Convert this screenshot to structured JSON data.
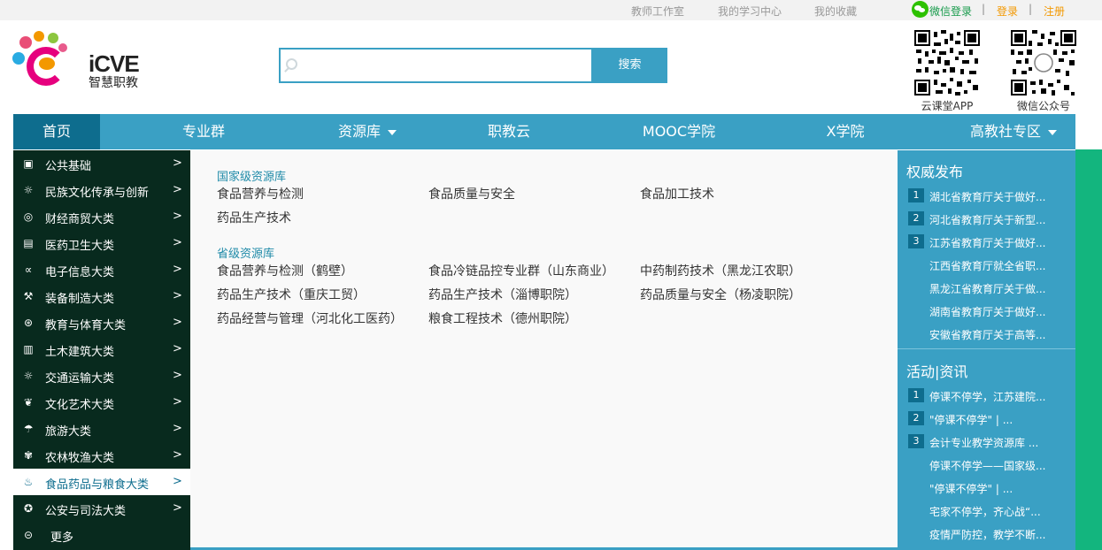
{
  "topbar": {
    "links": [
      "教师工作室",
      "我的学习中心",
      "我的收藏"
    ],
    "wechat_login": "微信登录",
    "login": "登录",
    "register": "注册",
    "separator": "|"
  },
  "brand": {
    "name": "iCVE",
    "subtitle": "智慧职教"
  },
  "search": {
    "placeholder": "",
    "button": "搜索"
  },
  "qr": {
    "app_label": "云课堂APP",
    "wechat_label": "微信公众号"
  },
  "nav": {
    "items": [
      "首页",
      "专业群",
      "资源库",
      "职教云",
      "MOOC学院",
      "X学院",
      "高教社专区"
    ]
  },
  "categories": [
    {
      "label": "公共基础",
      "icon": "book-icon"
    },
    {
      "label": "民族文化传承与创新",
      "icon": "lamp-icon"
    },
    {
      "label": "财经商贸大类",
      "icon": "coin-icon"
    },
    {
      "label": "医药卫生大类",
      "icon": "medical-icon"
    },
    {
      "label": "电子信息大类",
      "icon": "share-icon"
    },
    {
      "label": "装备制造大类",
      "icon": "wrench-icon"
    },
    {
      "label": "教育与体育大类",
      "icon": "ball-icon"
    },
    {
      "label": "土木建筑大类",
      "icon": "building-icon"
    },
    {
      "label": "交通运输大类",
      "icon": "bulb-icon"
    },
    {
      "label": "文化艺术大类",
      "icon": "leaf-icon"
    },
    {
      "label": "旅游大类",
      "icon": "umbrella-icon"
    },
    {
      "label": "农林牧渔大类",
      "icon": "wheat-icon"
    },
    {
      "label": "食品药品与粮食大类",
      "icon": "bowl-icon"
    },
    {
      "label": "公安与司法大类",
      "icon": "badge-icon"
    },
    {
      "label": "更多",
      "icon": "more-icon"
    }
  ],
  "category_arrow": ">",
  "national": {
    "title": "国家级资源库",
    "items": [
      "食品营养与检测",
      "食品质量与安全",
      "食品加工技术",
      "药品生产技术"
    ]
  },
  "provincial": {
    "title": "省级资源库",
    "items": [
      "食品营养与检测（鹤壁）",
      "食品冷链品控专业群（山东商业）",
      "中药制药技术（黑龙江农职）",
      "药品生产技术（重庆工贸）",
      "药品生产技术（淄博职院）",
      "药品质量与安全（杨凌职院）",
      "药品经营与管理（河北化工医药）",
      "粮食工程技术（德州职院）"
    ]
  },
  "authority": {
    "title": "权威发布",
    "items": [
      {
        "num": "1",
        "text": "湖北省教育厅关于做好..."
      },
      {
        "num": "2",
        "text": "河北省教育厅关于新型..."
      },
      {
        "num": "3",
        "text": "江苏省教育厅关于做好..."
      },
      {
        "num": "",
        "text": "江西省教育厅就全省职..."
      },
      {
        "num": "",
        "text": "黑龙江省教育厅关于做..."
      },
      {
        "num": "",
        "text": "湖南省教育厅关于做好..."
      },
      {
        "num": "",
        "text": "安徽省教育厅关于高等..."
      }
    ]
  },
  "news": {
    "title": "活动|资讯",
    "items": [
      {
        "num": "1",
        "text": "停课不停学，江苏建院..."
      },
      {
        "num": "2",
        "text": "\"停课不停学\" | ..."
      },
      {
        "num": "3",
        "text": "会计专业教学资源库 ..."
      },
      {
        "num": "",
        "text": "停课不停学——国家级..."
      },
      {
        "num": "",
        "text": "\"停课不停学\" | ..."
      },
      {
        "num": "",
        "text": "宅家不停学，齐心战“..."
      },
      {
        "num": "",
        "text": "疫情严防控，教学不断..."
      }
    ]
  },
  "colors": {
    "primary": "#3aa0c4",
    "nav_active": "#0e6d8e",
    "sidebar": "#082a1e",
    "green_band": "#13b57e"
  }
}
